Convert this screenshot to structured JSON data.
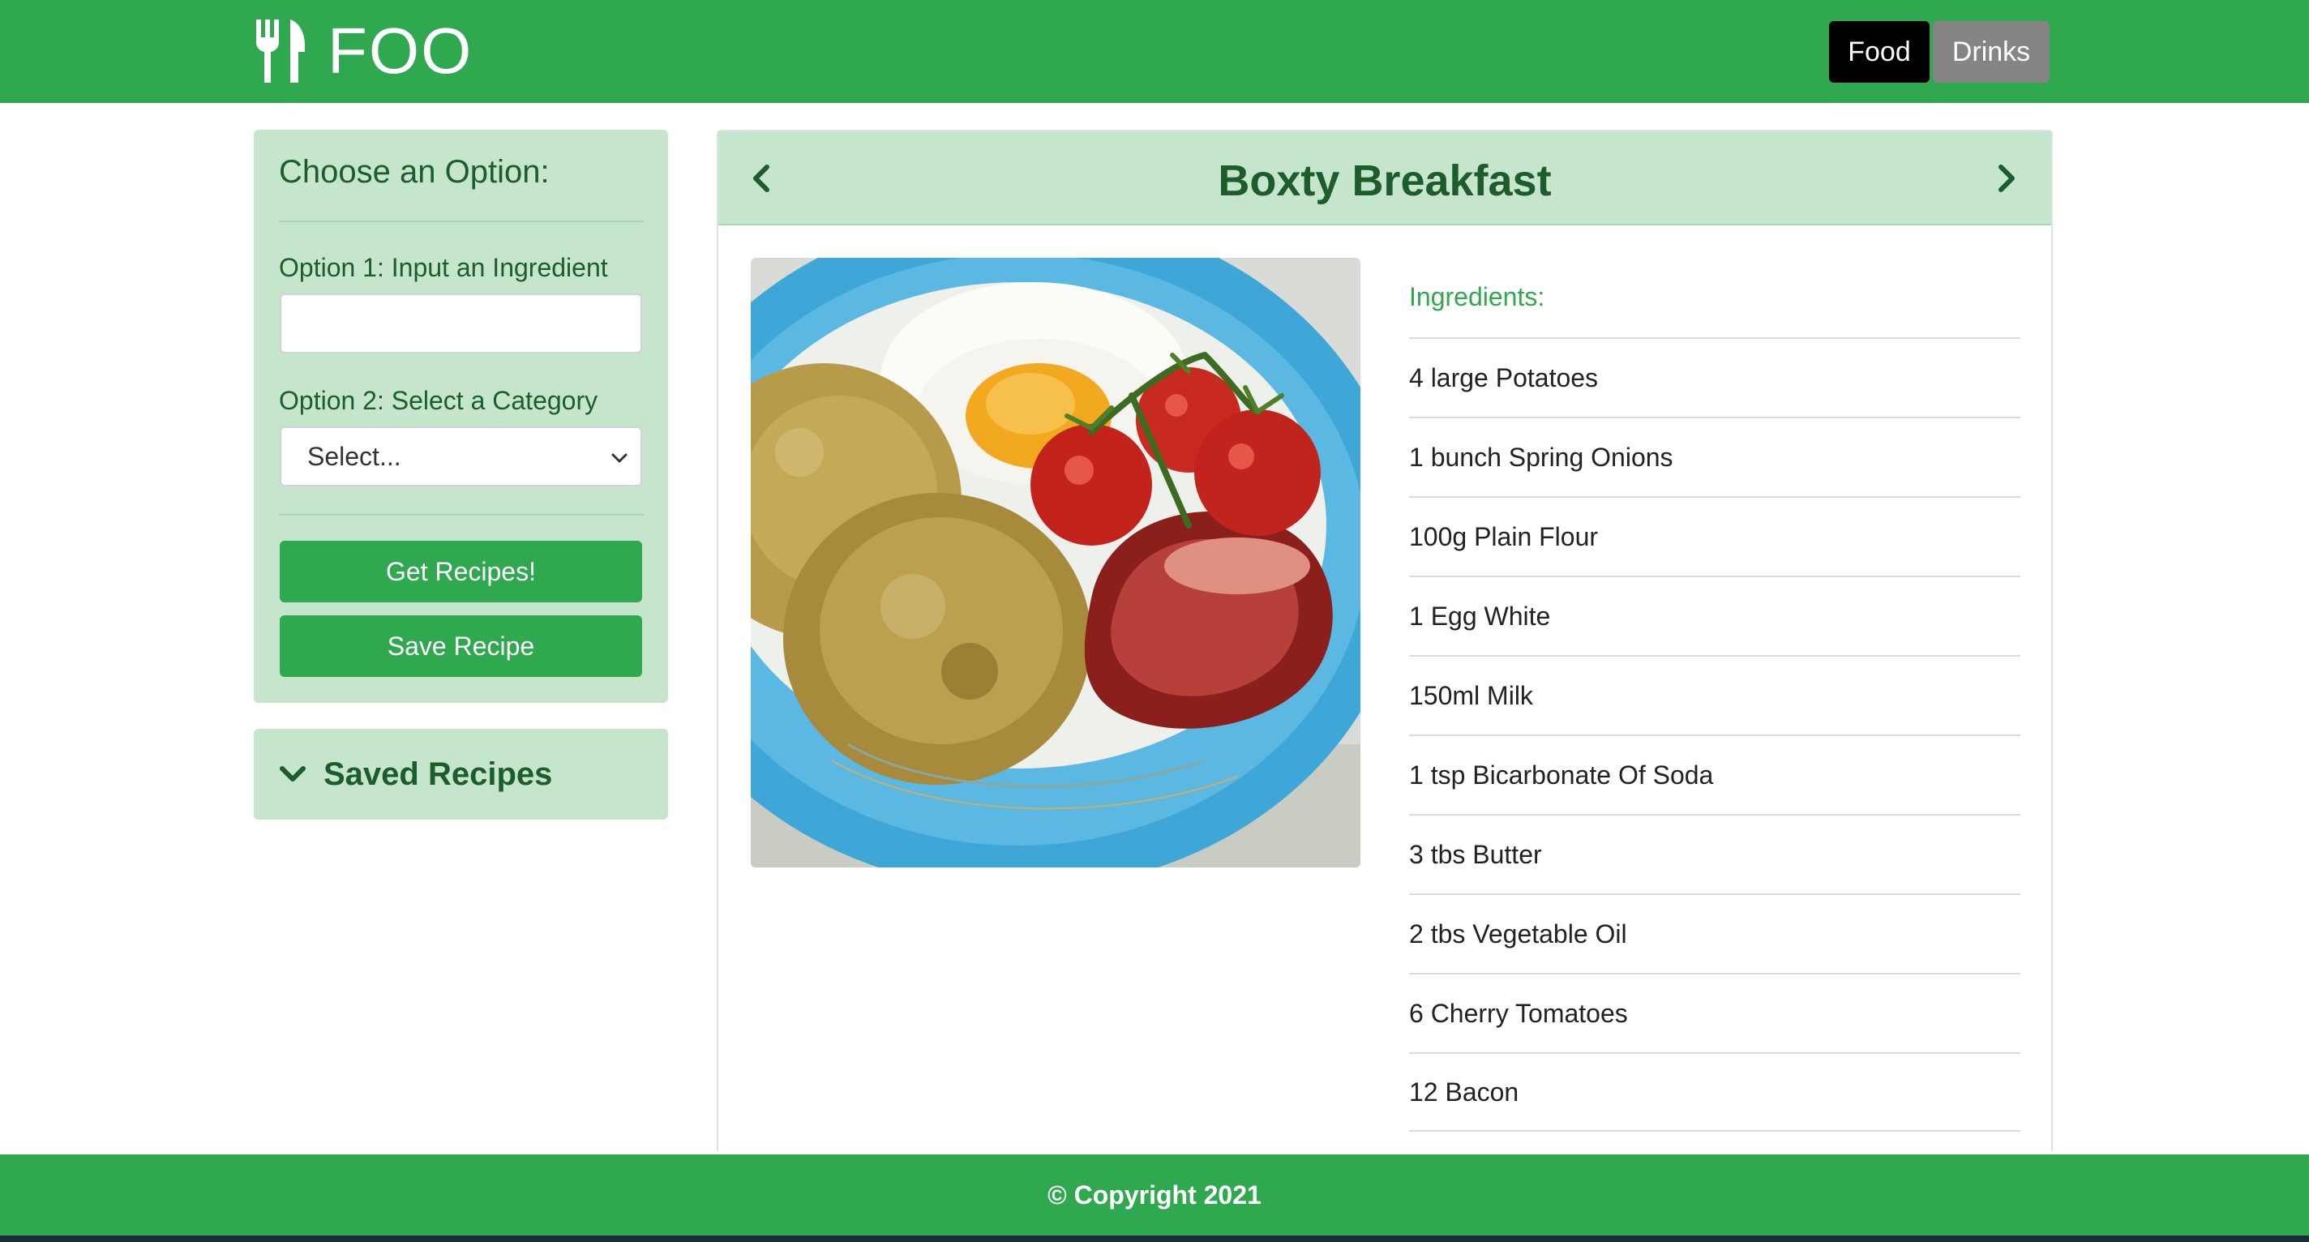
{
  "header": {
    "brand": "FOO",
    "brand_icon": "utensils-icon",
    "nav": [
      {
        "label": "Food",
        "active": true
      },
      {
        "label": "Drinks",
        "active": false
      }
    ]
  },
  "sidebar": {
    "title": "Choose an Option:",
    "option1_label": "Option 1: Input an Ingredient",
    "ingredient_input": {
      "value": "",
      "placeholder": ""
    },
    "option2_label": "Option 2: Select a Category",
    "category_select": {
      "selected": "Select..."
    },
    "get_recipes_label": "Get Recipes!",
    "save_recipe_label": "Save Recipe",
    "saved_recipes_label": "Saved Recipes"
  },
  "recipe": {
    "title": "Boxty Breakfast",
    "image_alt": "Boxty breakfast plate with fried egg, cherry tomatoes and bacon",
    "ingredients_heading": "Ingredients:",
    "ingredients": [
      "4 large Potatoes",
      "1 bunch Spring Onions",
      "100g Plain Flour",
      "1 Egg White",
      "150ml Milk",
      "1 tsp Bicarbonate Of Soda",
      "3 tbs Butter",
      "2 tbs Vegetable Oil",
      "6 Cherry Tomatoes",
      "12 Bacon"
    ]
  },
  "footer": {
    "copyright": "© Copyright 2021"
  },
  "colors": {
    "brand_green": "#2fa84f",
    "panel_green": "#c5e6cd",
    "dark_green_text": "#1d5c2c"
  }
}
